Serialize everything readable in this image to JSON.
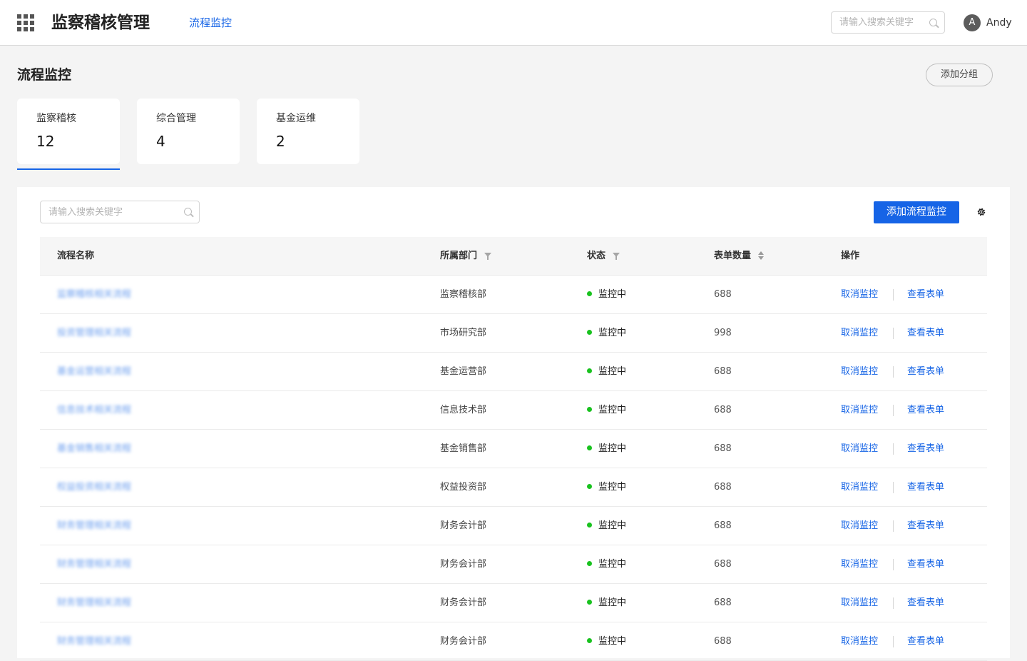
{
  "header": {
    "app_title": "监察稽核管理",
    "nav_item": "流程监控",
    "search_placeholder": "请输入搜索关键字",
    "user": {
      "initial": "A",
      "name": "Andy"
    }
  },
  "page": {
    "title": "流程监控",
    "add_group_label": "添加分组"
  },
  "groups": [
    {
      "label": "监察稽核",
      "count": "12",
      "active": true
    },
    {
      "label": "综合管理",
      "count": "4",
      "active": false
    },
    {
      "label": "基金运维",
      "count": "2",
      "active": false
    }
  ],
  "table": {
    "search_placeholder": "请输入搜索关键字",
    "add_button_label": "添加流程监控",
    "columns": {
      "name": "流程名称",
      "department": "所属部门",
      "status": "状态",
      "form_count": "表单数量",
      "actions": "操作"
    },
    "rows": [
      {
        "name": "监察稽核相关流程",
        "department": "监察稽核部",
        "status": "监控中",
        "form_count": "688",
        "action_cancel": "取消监控",
        "action_view": "查看表单"
      },
      {
        "name": "投资管理相关流程",
        "department": "市场研究部",
        "status": "监控中",
        "form_count": "998",
        "action_cancel": "取消监控",
        "action_view": "查看表单"
      },
      {
        "name": "基金运营相关流程",
        "department": "基金运营部",
        "status": "监控中",
        "form_count": "688",
        "action_cancel": "取消监控",
        "action_view": "查看表单"
      },
      {
        "name": "信息技术相关流程",
        "department": "信息技术部",
        "status": "监控中",
        "form_count": "688",
        "action_cancel": "取消监控",
        "action_view": "查看表单"
      },
      {
        "name": "基金销售相关流程",
        "department": "基金销售部",
        "status": "监控中",
        "form_count": "688",
        "action_cancel": "取消监控",
        "action_view": "查看表单"
      },
      {
        "name": "权益投资相关流程",
        "department": "权益投资部",
        "status": "监控中",
        "form_count": "688",
        "action_cancel": "取消监控",
        "action_view": "查看表单"
      },
      {
        "name": "财务管理相关流程",
        "department": "财务会计部",
        "status": "监控中",
        "form_count": "688",
        "action_cancel": "取消监控",
        "action_view": "查看表单"
      },
      {
        "name": "财务管理相关流程",
        "department": "财务会计部",
        "status": "监控中",
        "form_count": "688",
        "action_cancel": "取消监控",
        "action_view": "查看表单"
      },
      {
        "name": "财务管理相关流程",
        "department": "财务会计部",
        "status": "监控中",
        "form_count": "688",
        "action_cancel": "取消监控",
        "action_view": "查看表单"
      },
      {
        "name": "财务管理相关流程",
        "department": "财务会计部",
        "status": "监控中",
        "form_count": "688",
        "action_cancel": "取消监控",
        "action_view": "查看表单"
      }
    ]
  },
  "colors": {
    "accent": "#1664e6",
    "status_ok": "#19c21f"
  }
}
